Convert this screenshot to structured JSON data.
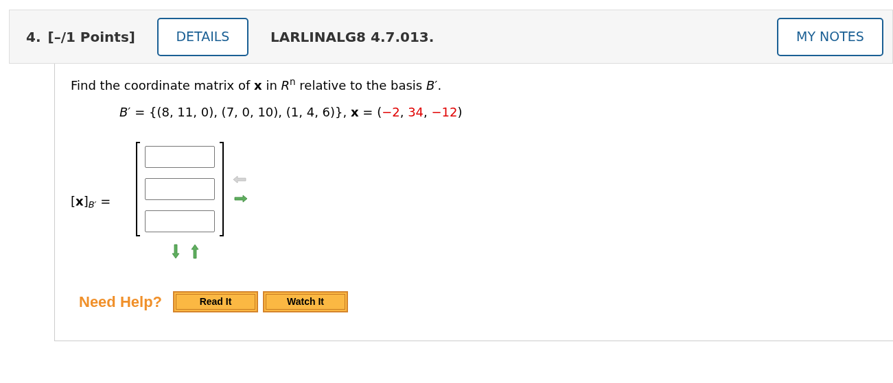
{
  "header": {
    "number": "4.",
    "points": "[–/1 Points]",
    "details_button": "DETAILS",
    "problem_id": "LARLINALG8 4.7.013.",
    "notes_button": "MY NOTES"
  },
  "question": {
    "prompt": "Find the coordinate matrix of **x** in *R*$^{n}$ relative to the basis *B*′.",
    "equation": {
      "lead": "*B*′ = {(8, 11, 0), (7, 0, 10), (1, 4, 6)}, **x** = (",
      "values": [
        "−2",
        "34",
        "−12"
      ],
      "separator": ", ",
      "close": ")"
    }
  },
  "answer": {
    "lhs": "[**x**]",
    "subscript": "B′",
    "equals": "=",
    "entries": [
      {
        "kind": "input"
      },
      {
        "kind": "input"
      },
      {
        "kind": "input"
      }
    ],
    "arrows": [
      {
        "kind": "left",
        "enabled": false
      },
      {
        "kind": "right",
        "enabled": true
      },
      {
        "kind": "down",
        "enabled": true
      },
      {
        "kind": "up",
        "enabled": true
      }
    ]
  },
  "help": {
    "label": "Need Help?",
    "buttons": [
      "Read It",
      "Watch It"
    ]
  }
}
